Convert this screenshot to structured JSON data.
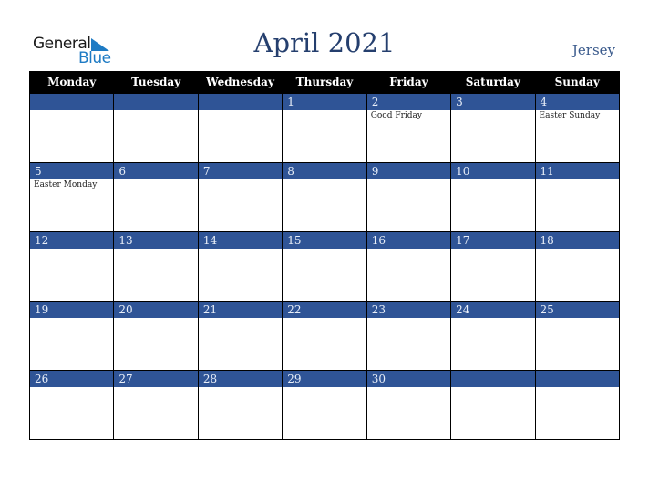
{
  "logo": {
    "word1": "General",
    "word2": "Blue",
    "accent": "#1e7bc4"
  },
  "header": {
    "title": "April 2021",
    "region": "Jersey"
  },
  "colors": {
    "band": "#2f5496",
    "header_bg": "#000000",
    "title": "#253f6e"
  },
  "weekdays": [
    "Monday",
    "Tuesday",
    "Wednesday",
    "Thursday",
    "Friday",
    "Saturday",
    "Sunday"
  ],
  "weeks": [
    [
      {
        "day": "",
        "holiday": ""
      },
      {
        "day": "",
        "holiday": ""
      },
      {
        "day": "",
        "holiday": ""
      },
      {
        "day": "1",
        "holiday": ""
      },
      {
        "day": "2",
        "holiday": "Good Friday"
      },
      {
        "day": "3",
        "holiday": ""
      },
      {
        "day": "4",
        "holiday": "Easter Sunday"
      }
    ],
    [
      {
        "day": "5",
        "holiday": "Easter Monday"
      },
      {
        "day": "6",
        "holiday": ""
      },
      {
        "day": "7",
        "holiday": ""
      },
      {
        "day": "8",
        "holiday": ""
      },
      {
        "day": "9",
        "holiday": ""
      },
      {
        "day": "10",
        "holiday": ""
      },
      {
        "day": "11",
        "holiday": ""
      }
    ],
    [
      {
        "day": "12",
        "holiday": ""
      },
      {
        "day": "13",
        "holiday": ""
      },
      {
        "day": "14",
        "holiday": ""
      },
      {
        "day": "15",
        "holiday": ""
      },
      {
        "day": "16",
        "holiday": ""
      },
      {
        "day": "17",
        "holiday": ""
      },
      {
        "day": "18",
        "holiday": ""
      }
    ],
    [
      {
        "day": "19",
        "holiday": ""
      },
      {
        "day": "20",
        "holiday": ""
      },
      {
        "day": "21",
        "holiday": ""
      },
      {
        "day": "22",
        "holiday": ""
      },
      {
        "day": "23",
        "holiday": ""
      },
      {
        "day": "24",
        "holiday": ""
      },
      {
        "day": "25",
        "holiday": ""
      }
    ],
    [
      {
        "day": "26",
        "holiday": ""
      },
      {
        "day": "27",
        "holiday": ""
      },
      {
        "day": "28",
        "holiday": ""
      },
      {
        "day": "29",
        "holiday": ""
      },
      {
        "day": "30",
        "holiday": ""
      },
      {
        "day": "",
        "holiday": ""
      },
      {
        "day": "",
        "holiday": ""
      }
    ]
  ]
}
